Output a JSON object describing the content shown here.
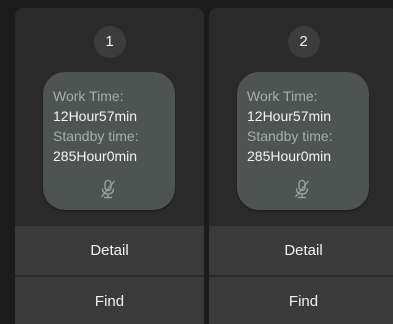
{
  "devices": [
    {
      "index": "1",
      "work_time_label": "Work Time:",
      "work_time_value": "12Hour57min",
      "standby_label": "Standby time:",
      "standby_value": "285Hour0min",
      "status_icon": "mic-muted-icon",
      "detail_label": "Detail",
      "find_label": "Find"
    },
    {
      "index": "2",
      "work_time_label": "Work Time:",
      "work_time_value": "12Hour57min",
      "standby_label": "Standby time:",
      "standby_value": "285Hour0min",
      "status_icon": "mic-muted-icon",
      "detail_label": "Detail",
      "find_label": "Find"
    }
  ],
  "colors": {
    "background": "#1b1b1b",
    "panel": "#2a2a2a",
    "card": "#4e5451",
    "button": "#3a3a3a",
    "label_text": "#a9aeab",
    "value_text": "#f5f5f5"
  }
}
